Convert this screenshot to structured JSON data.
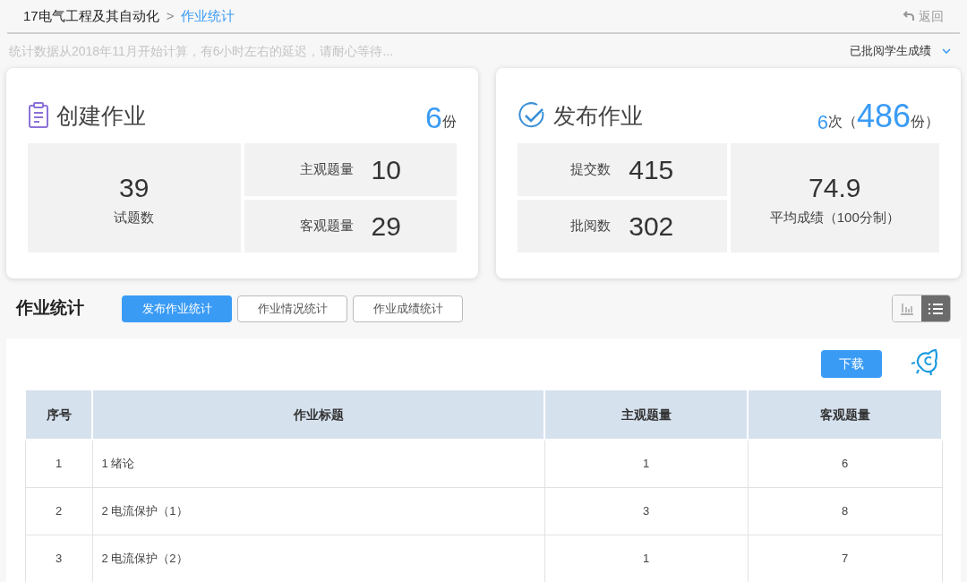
{
  "breadcrumb": {
    "parent": "17电气工程及其自动化",
    "separator": ">",
    "current": "作业统计"
  },
  "back": {
    "label": "返回"
  },
  "notice": "统计数据从2018年11月开始计算，有6小时左右的延迟，请耐心等待...",
  "filter": {
    "value": "已批阅学生成绩"
  },
  "create_card": {
    "title": "创建作业",
    "count": "6",
    "unit": "份",
    "total": {
      "value": "39",
      "label": "试题数"
    },
    "stats": [
      {
        "label": "主观题量",
        "value": "10"
      },
      {
        "label": "客观题量",
        "value": "29"
      }
    ]
  },
  "publish_card": {
    "title": "发布作业",
    "times": "6",
    "times_unit": "次",
    "open": "（",
    "count": "486",
    "unit": "份）",
    "stats": [
      {
        "label": "提交数",
        "value": "415"
      },
      {
        "label": "批阅数",
        "value": "302"
      }
    ],
    "average": {
      "value": "74.9",
      "label": "平均成绩（100分制）"
    }
  },
  "section": {
    "title": "作业统计",
    "tabs": [
      {
        "label": "发布作业统计",
        "selected": true
      },
      {
        "label": "作业情况统计",
        "selected": false
      },
      {
        "label": "作业成绩统计",
        "selected": false
      }
    ],
    "views": [
      {
        "kind": "chart",
        "selected": false
      },
      {
        "kind": "list",
        "selected": true
      }
    ]
  },
  "download": "下载",
  "table": {
    "columns": [
      "序号",
      "作业标题",
      "主观题量",
      "客观题量"
    ],
    "rows": [
      [
        "1",
        "1 绪论",
        "1",
        "6"
      ],
      [
        "2",
        "2 电流保护（1）",
        "3",
        "8"
      ],
      [
        "3",
        "2 电流保护（2）",
        "1",
        "7"
      ]
    ]
  }
}
